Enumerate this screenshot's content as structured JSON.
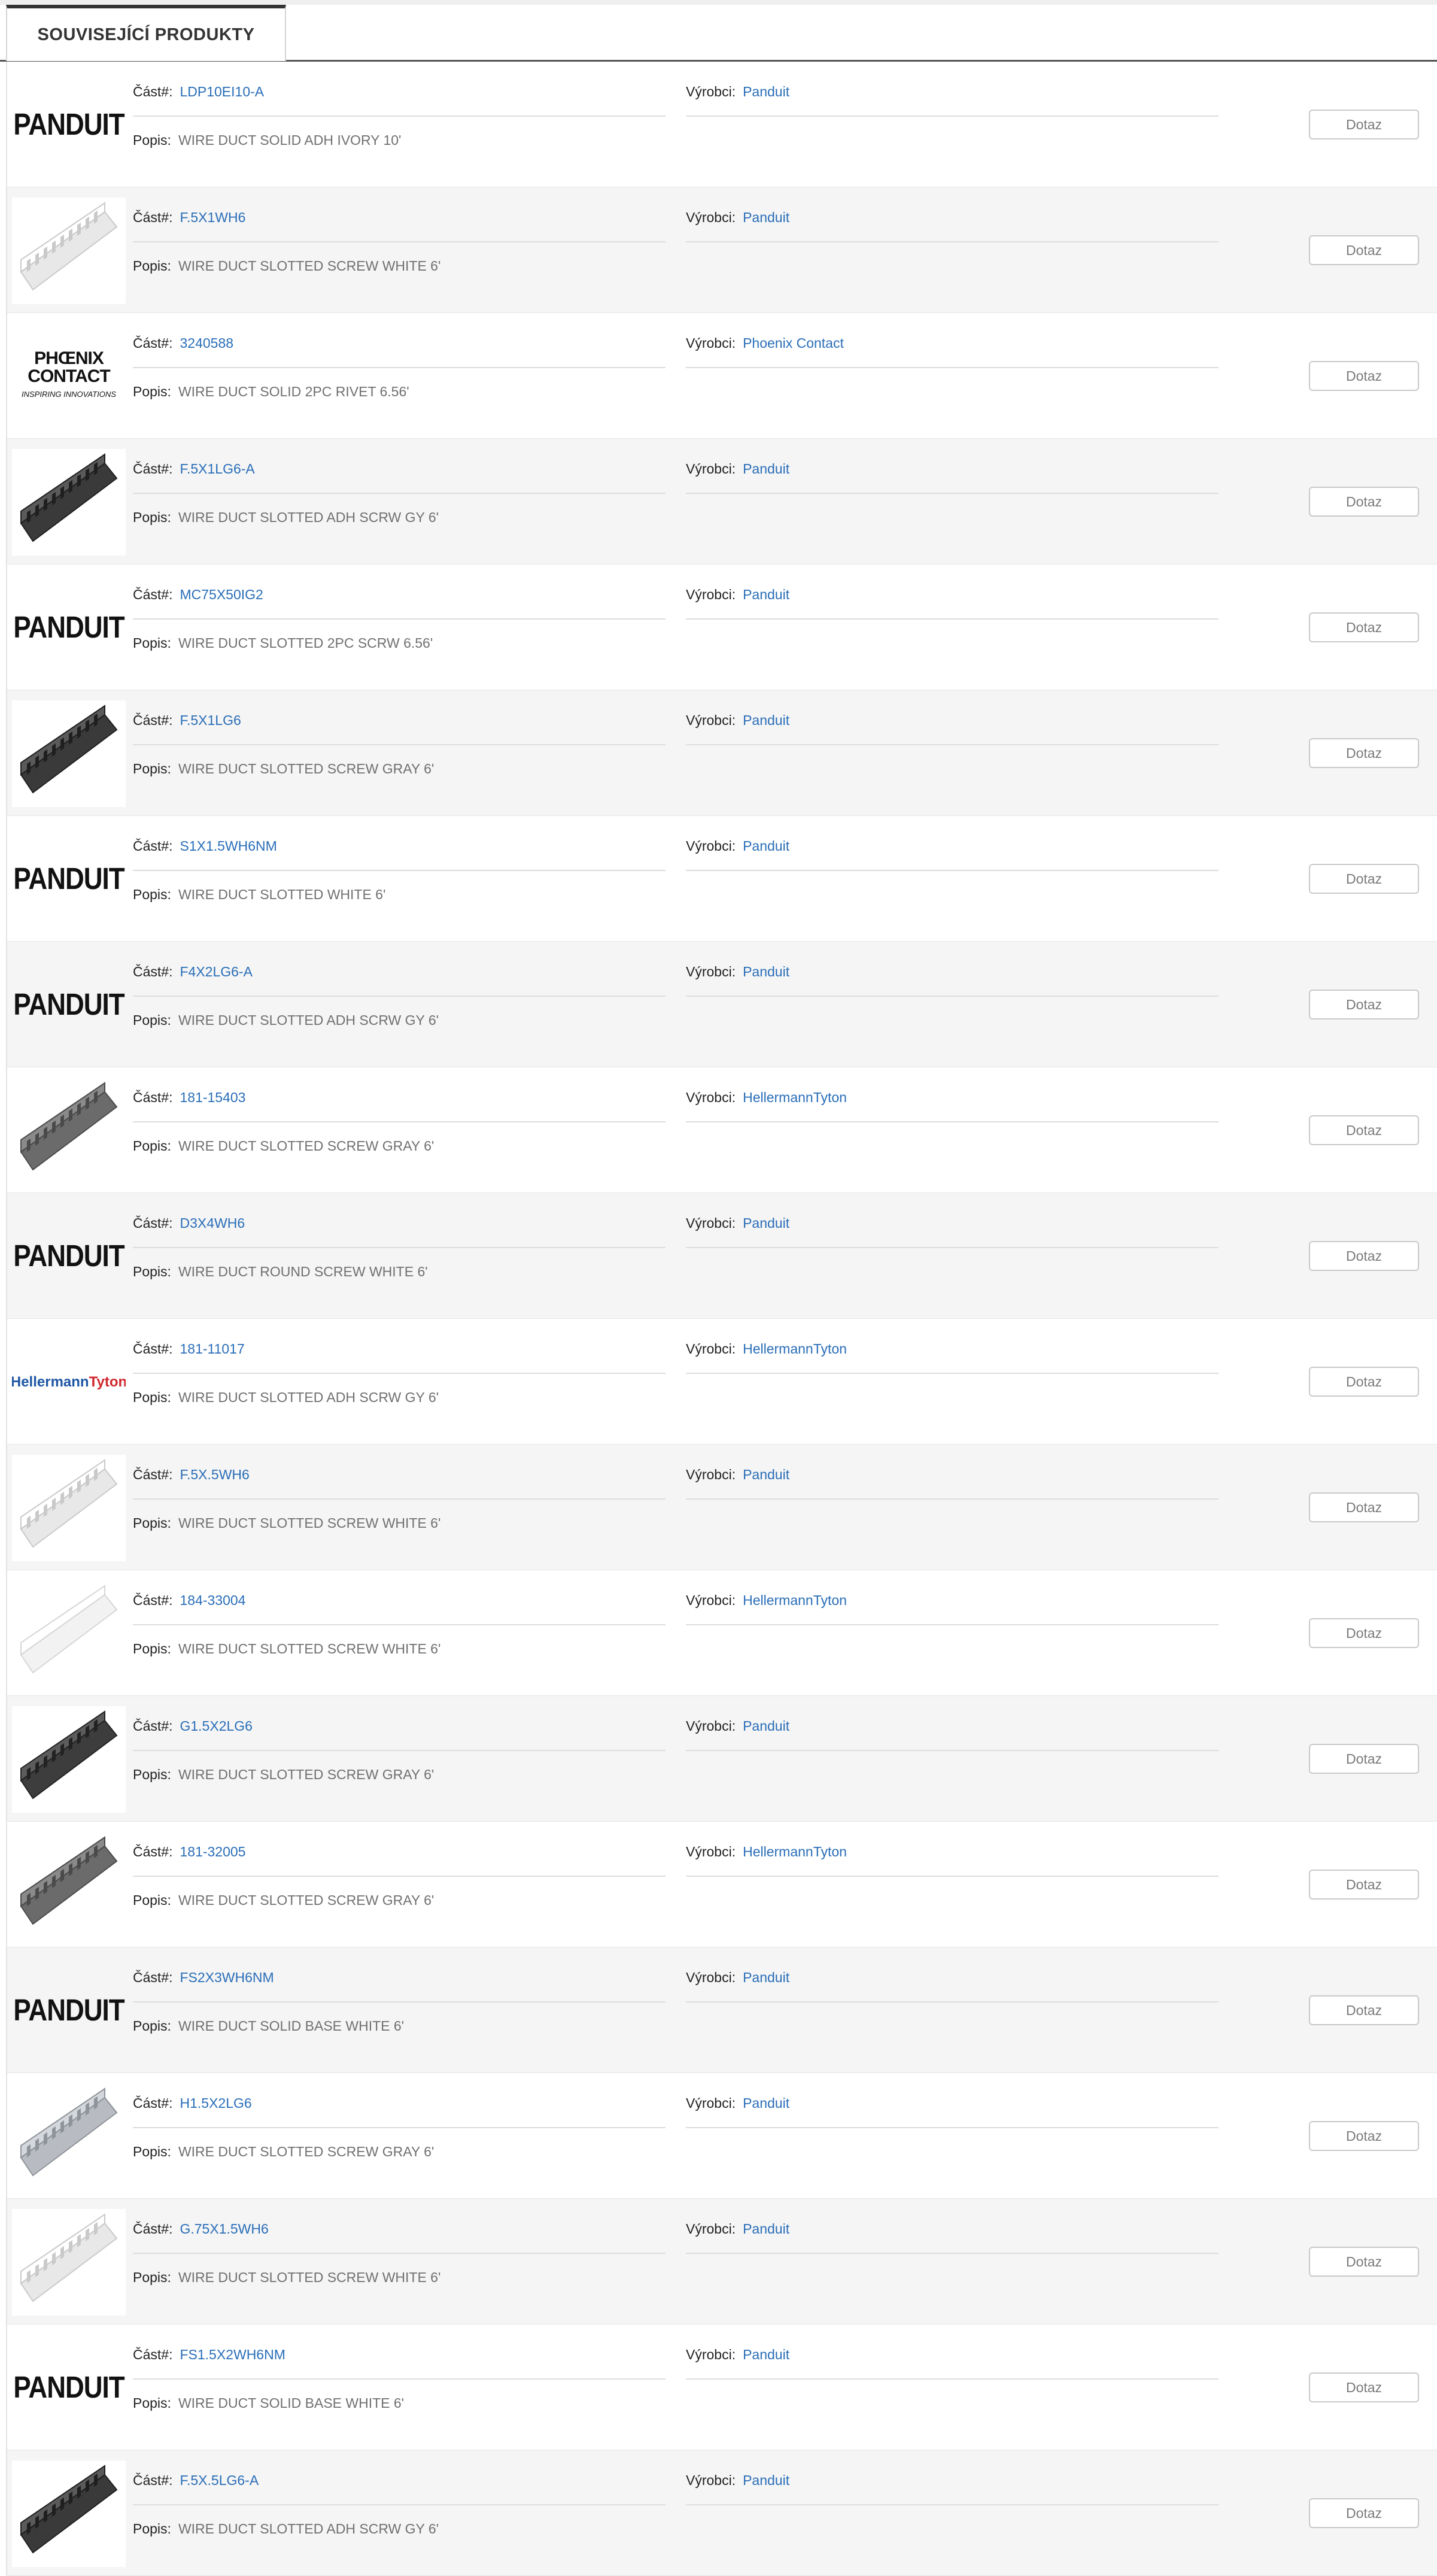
{
  "tab": {
    "label": "SOUVISEJÍCÍ PRODUKTY"
  },
  "labels": {
    "part": "Část#:",
    "maker": "Výrobci:",
    "desc": "Popis:",
    "button": "Dotaz"
  },
  "brands": {
    "panduit": "PANDUIT",
    "phoenix_line1": "PHŒNIX",
    "phoenix_line2": "CONTACT",
    "phoenix_tag": "INSPIRING INNOVATIONS",
    "ht_part1": "Hellermann",
    "ht_part2": "Tyton"
  },
  "colors": {
    "link": "#2a6eb8",
    "alt_row": "#f5f5f5",
    "ht_blue": "#1f57a5",
    "ht_red": "#d0282d"
  },
  "products": [
    {
      "part": "LDP10EI10-A",
      "maker": "Panduit",
      "desc": "WIRE DUCT SOLID ADH IVORY 10'",
      "image": "panduit-logo"
    },
    {
      "part": "F.5X1WH6",
      "maker": "Panduit",
      "desc": "WIRE DUCT SLOTTED SCREW WHITE 6'",
      "image": "duct-white"
    },
    {
      "part": "3240588",
      "maker": "Phoenix Contact",
      "desc": "WIRE DUCT SOLID 2PC RIVET 6.56'",
      "image": "phoenix-logo"
    },
    {
      "part": "F.5X1LG6-A",
      "maker": "Panduit",
      "desc": "WIRE DUCT SLOTTED ADH SCRW GY 6'",
      "image": "duct-dark"
    },
    {
      "part": "MC75X50IG2",
      "maker": "Panduit",
      "desc": "WIRE DUCT SLOTTED 2PC SCRW 6.56'",
      "image": "panduit-logo"
    },
    {
      "part": "F.5X1LG6",
      "maker": "Panduit",
      "desc": "WIRE DUCT SLOTTED SCREW GRAY 6'",
      "image": "duct-dark"
    },
    {
      "part": "S1X1.5WH6NM",
      "maker": "Panduit",
      "desc": "WIRE DUCT SLOTTED WHITE 6'",
      "image": "panduit-logo"
    },
    {
      "part": "F4X2LG6-A",
      "maker": "Panduit",
      "desc": "WIRE DUCT SLOTTED ADH SCRW GY 6'",
      "image": "panduit-logo"
    },
    {
      "part": "181-15403",
      "maker": "HellermannTyton",
      "desc": "WIRE DUCT SLOTTED SCREW GRAY 6'",
      "image": "duct-gray"
    },
    {
      "part": "D3X4WH6",
      "maker": "Panduit",
      "desc": "WIRE DUCT ROUND SCREW WHITE 6'",
      "image": "panduit-logo"
    },
    {
      "part": "181-11017",
      "maker": "HellermannTyton",
      "desc": "WIRE DUCT SLOTTED ADH SCRW GY 6'",
      "image": "ht-logo"
    },
    {
      "part": "F.5X.5WH6",
      "maker": "Panduit",
      "desc": "WIRE DUCT SLOTTED SCREW WHITE 6'",
      "image": "duct-white"
    },
    {
      "part": "184-33004",
      "maker": "HellermannTyton",
      "desc": "WIRE DUCT SLOTTED SCREW WHITE 6'",
      "image": "duct-white-solid"
    },
    {
      "part": "G1.5X2LG6",
      "maker": "Panduit",
      "desc": "WIRE DUCT SLOTTED SCREW GRAY 6'",
      "image": "duct-dark-big"
    },
    {
      "part": "181-32005",
      "maker": "HellermannTyton",
      "desc": "WIRE DUCT SLOTTED SCREW GRAY 6'",
      "image": "duct-gray"
    },
    {
      "part": "FS2X3WH6NM",
      "maker": "Panduit",
      "desc": "WIRE DUCT SOLID BASE WHITE 6'",
      "image": "panduit-logo"
    },
    {
      "part": "H1.5X2LG6",
      "maker": "Panduit",
      "desc": "WIRE DUCT SLOTTED SCREW GRAY 6'",
      "image": "duct-lightgray"
    },
    {
      "part": "G.75X1.5WH6",
      "maker": "Panduit",
      "desc": "WIRE DUCT SLOTTED SCREW WHITE 6'",
      "image": "duct-white"
    },
    {
      "part": "FS1.5X2WH6NM",
      "maker": "Panduit",
      "desc": "WIRE DUCT SOLID BASE WHITE 6'",
      "image": "panduit-logo"
    },
    {
      "part": "F.5X.5LG6-A",
      "maker": "Panduit",
      "desc": "WIRE DUCT SLOTTED ADH SCRW GY 6'",
      "image": "duct-dark"
    }
  ]
}
